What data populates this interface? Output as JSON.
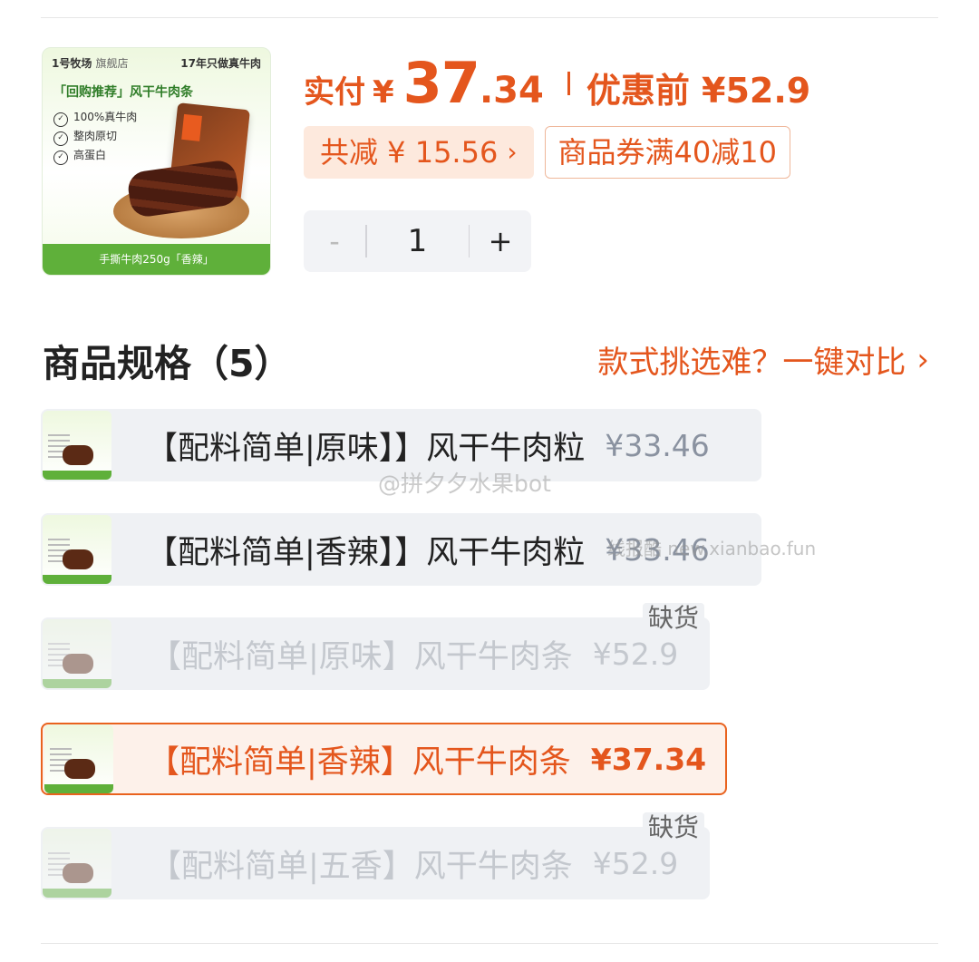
{
  "product": {
    "image_brand": "1号牧场",
    "image_store": "旗舰店",
    "image_slogan": "17年只做真牛肉",
    "image_headline": "「回购推荐」风干牛肉条",
    "image_bullets": [
      "100%真牛肉",
      "整肉原切",
      "高蛋白"
    ],
    "image_footer": "手撕牛肉250g「香辣」"
  },
  "price": {
    "paid_label": "实付",
    "currency": "¥",
    "integer": "37",
    "decimal": ".34",
    "original_label": "优惠前 ¥52.9"
  },
  "discounts": {
    "total_reduction": "共减 ¥ 15.56",
    "coupon": "商品券满40减10"
  },
  "stepper": {
    "minus": "-",
    "quantity": "1",
    "plus": "+"
  },
  "spec": {
    "title": "商品规格（5）",
    "compare_link": "款式挑选难？一键对比",
    "options": [
      {
        "label": "【配料简单|原味】】风干牛肉粒",
        "price": "¥33.46",
        "status": "available"
      },
      {
        "label": "【配料简单|香辣】】风干牛肉粒",
        "price": "¥33.46",
        "status": "available"
      },
      {
        "label": "【配料简单|原味】风干牛肉条",
        "price": "¥52.9",
        "status": "out_of_stock",
        "badge": "缺货"
      },
      {
        "label": "【配料简单|香辣】风干牛肉条",
        "price": "¥37.34",
        "status": "selected"
      },
      {
        "label": "【配料简单|五香】风干牛肉条",
        "price": "¥52.9",
        "status": "out_of_stock",
        "badge": "缺货"
      }
    ]
  },
  "watermarks": {
    "weibo": "@拼夕夕水果bot",
    "site": "线报酷 new.xianbao.fun"
  },
  "colors": {
    "accent": "#e4561d",
    "brand_green": "#5fb03a",
    "chip_bg": "#fde9dd",
    "option_bg": "#eff1f4"
  }
}
